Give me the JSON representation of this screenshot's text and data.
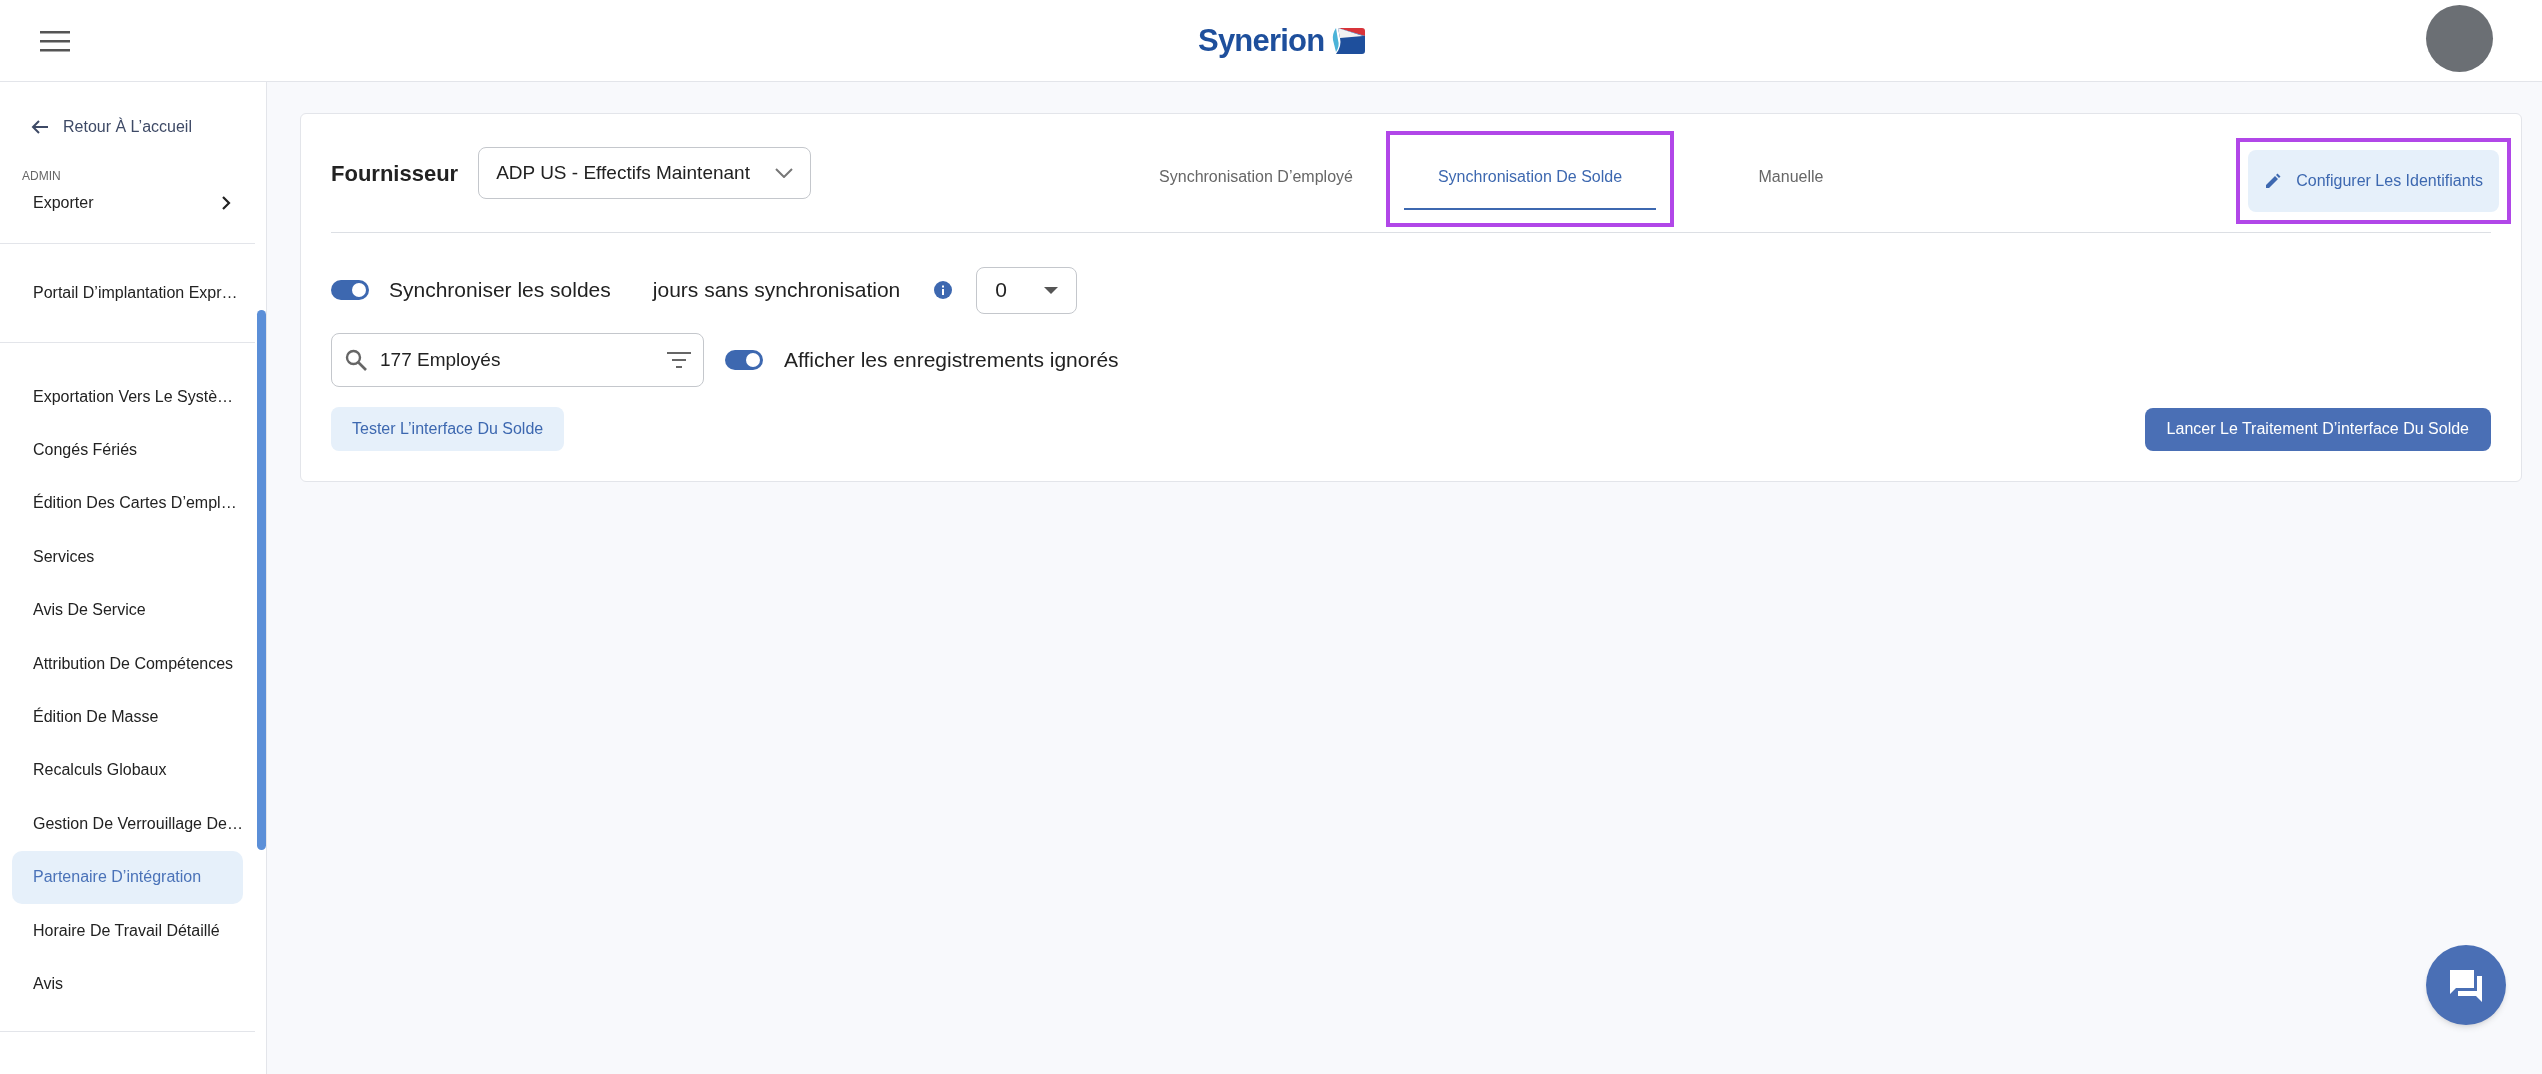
{
  "header": {
    "logo_text": "Synerion"
  },
  "sidebar": {
    "back_link": "Retour À L’accueil",
    "section_label": "ADMIN",
    "groups": [
      {
        "items": [
          {
            "label": "Exporter",
            "kind": "submenu",
            "selected": false
          }
        ]
      },
      {
        "items": [
          {
            "label": "Portail D’implantation Expr…",
            "kind": "link",
            "selected": false
          }
        ]
      },
      {
        "items": [
          {
            "label": "Exportation Vers Le Systè…",
            "kind": "link",
            "selected": false
          },
          {
            "label": "Congés Fériés",
            "kind": "link",
            "selected": false
          },
          {
            "label": "Édition Des Cartes D’empl…",
            "kind": "link",
            "selected": false
          },
          {
            "label": "Services",
            "kind": "link",
            "selected": false
          },
          {
            "label": "Avis De Service",
            "kind": "link",
            "selected": false
          },
          {
            "label": "Attribution De Compétences",
            "kind": "link",
            "selected": false
          },
          {
            "label": "Édition De Masse",
            "kind": "link",
            "selected": false
          },
          {
            "label": "Recalculs Globaux",
            "kind": "link",
            "selected": false
          },
          {
            "label": "Gestion De Verrouillage De…",
            "kind": "link",
            "selected": false
          },
          {
            "label": "Partenaire D’intégration",
            "kind": "link",
            "selected": true
          },
          {
            "label": "Horaire De Travail Détaillé",
            "kind": "link",
            "selected": false
          },
          {
            "label": "Avis",
            "kind": "link",
            "selected": false
          }
        ]
      }
    ]
  },
  "panel": {
    "provider_label": "Fournisseur",
    "provider_value": "ADP US - Effectifs Maintenant",
    "tabs": [
      {
        "label": "Synchronisation D’employé",
        "selected": false,
        "highlighted": false
      },
      {
        "label": "Synchronisation De Solde",
        "selected": true,
        "highlighted": true
      },
      {
        "label": "Manuelle",
        "selected": false,
        "highlighted": false
      }
    ],
    "configure_button": {
      "label": "Configurer Les Identifiants",
      "highlighted": true
    },
    "sync_toggle": {
      "label": "Synchroniser les soldes",
      "on": true
    },
    "days_label": "jours sans synchronisation",
    "days_value": "0",
    "search": {
      "value": "177 Employés"
    },
    "ignored_toggle": {
      "label": "Afficher les enregistrements ignorés",
      "on": true
    },
    "test_button": "Tester L’interface Du Solde",
    "run_button": "Lancer Le Traitement D’interface Du Solde"
  }
}
